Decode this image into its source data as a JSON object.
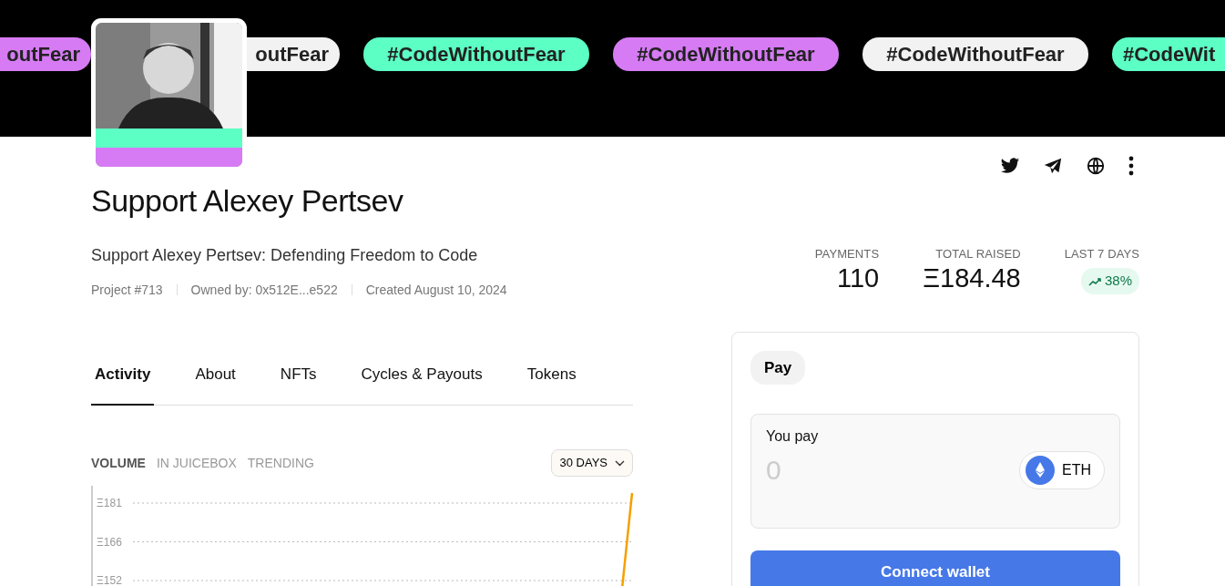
{
  "banner": {
    "tags": [
      {
        "text": "outFear",
        "color": "#d67bf4"
      },
      {
        "text": "outFear",
        "color": "#f2f2f2"
      },
      {
        "text": "#CodeWithoutFear",
        "color": "#5cffc4"
      },
      {
        "text": "#CodeWithoutFear",
        "color": "#d67bf4"
      },
      {
        "text": "#CodeWithoutFear",
        "color": "#f2f2f2"
      },
      {
        "text": "#CodeWit",
        "color": "#5cffc4"
      }
    ]
  },
  "project": {
    "title": "Support Alexey Pertsev",
    "description": "Support Alexey Pertsev: Defending Freedom to Code",
    "meta": [
      "Project #713",
      "Owned by: 0x512E...e522",
      "Created August 10, 2024"
    ]
  },
  "stats": [
    {
      "label": "PAYMENTS",
      "value": "110",
      "kind": "number"
    },
    {
      "label": "TOTAL RAISED",
      "value": "Ξ184.48",
      "kind": "number"
    },
    {
      "label": "LAST 7 DAYS",
      "value": "38%",
      "kind": "trend"
    }
  ],
  "tabs": [
    {
      "label": "Activity",
      "selected": true
    },
    {
      "label": "About",
      "selected": false
    },
    {
      "label": "NFTs",
      "selected": false
    },
    {
      "label": "Cycles & Payouts",
      "selected": false
    },
    {
      "label": "Tokens",
      "selected": false
    }
  ],
  "chart_tabs": [
    {
      "label": "VOLUME",
      "selected": true
    },
    {
      "label": "IN JUICEBOX",
      "selected": false
    },
    {
      "label": "TRENDING",
      "selected": false
    }
  ],
  "range_select": {
    "value": "30 DAYS"
  },
  "volume_chart": {
    "y_labels": [
      "Ξ181",
      "Ξ166",
      "Ξ152"
    ]
  },
  "pay_card": {
    "tabs": [
      {
        "label": "Pay",
        "selected": true
      }
    ],
    "field_label": "You pay",
    "placeholder": "0",
    "currency": "ETH",
    "button": "Connect wallet"
  }
}
